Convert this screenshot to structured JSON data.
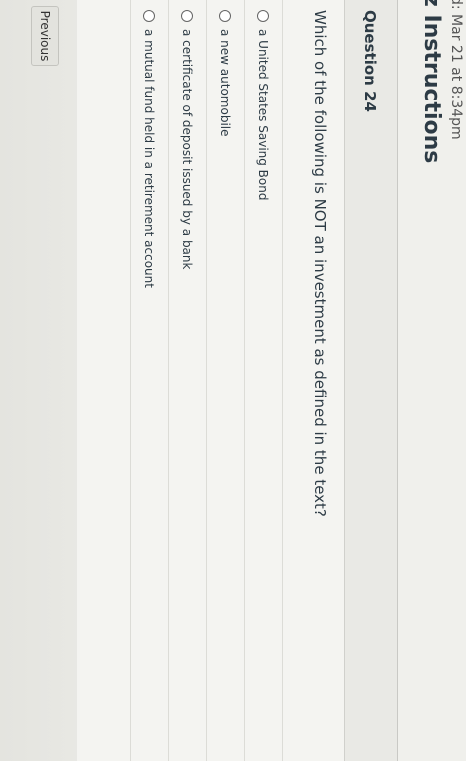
{
  "header": {
    "date_line": "d: Mar 21 at 8:34pm",
    "title": "z Instructions"
  },
  "question": {
    "title": "Question 24",
    "text": "Which of the following is NOT an investment as defined in the text?",
    "answers": [
      {
        "label": "a United States Saving Bond"
      },
      {
        "label": "a new automobile"
      },
      {
        "label": "a certificate of deposit issued by a bank"
      },
      {
        "label": "a mutual fund held in a retirement account"
      }
    ]
  },
  "nav": {
    "previous_label": "Previous"
  }
}
